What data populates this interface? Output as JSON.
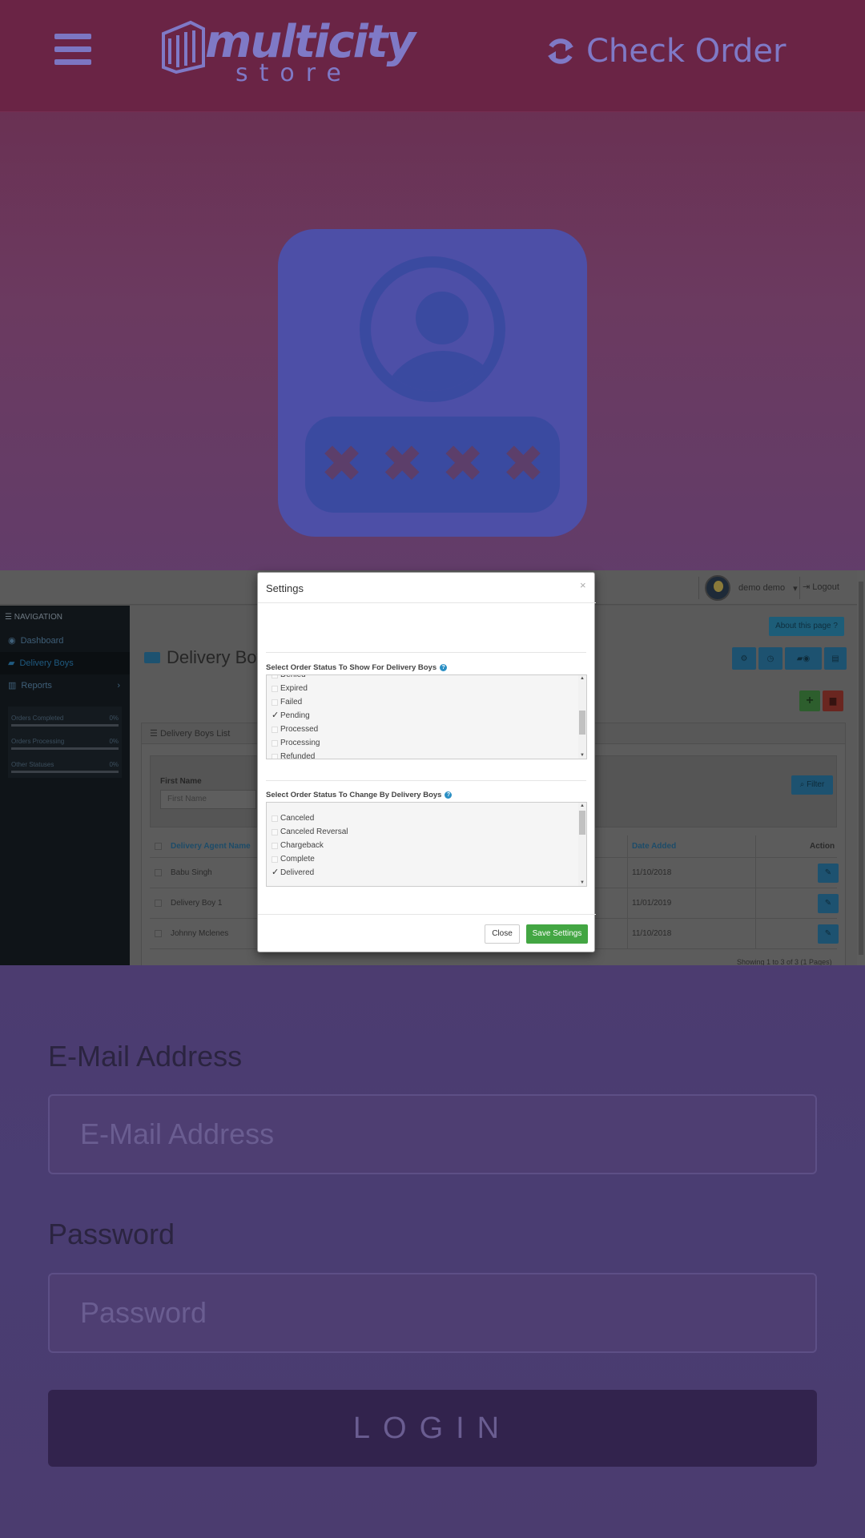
{
  "app": {
    "logo_word1": "multicity",
    "logo_word2": "store",
    "check_order_label": "Check Order"
  },
  "illustration": {
    "masked_password": [
      "✖",
      "✖",
      "✖",
      "✖"
    ]
  },
  "admin": {
    "user_name": "demo demo",
    "logout_label": "Logout",
    "nav_title": "NAVIGATION",
    "nav_items": [
      {
        "label": "Dashboard",
        "icon": "dashboard-icon"
      },
      {
        "label": "Delivery Boys",
        "icon": "truck-icon"
      },
      {
        "label": "Reports",
        "icon": "bar-chart-icon"
      }
    ],
    "stats": [
      {
        "label": "Orders Completed",
        "value": "0%"
      },
      {
        "label": "Orders Processing",
        "value": "0%"
      },
      {
        "label": "Other Statuses",
        "value": "0%"
      }
    ],
    "about_label": "About this page",
    "page_title": "Delivery Boys",
    "panel_title": "Delivery Boys List",
    "filter": {
      "label": "First Name",
      "placeholder": "First Name",
      "button_label": "Filter"
    },
    "table": {
      "headers": {
        "name": "Delivery Agent Name",
        "date": "Date Added",
        "action": "Action"
      },
      "rows": [
        {
          "name": "Babu Singh",
          "date": "11/10/2018"
        },
        {
          "name": "Delivery Boy 1",
          "date": "11/01/2019"
        },
        {
          "name": "Johnny Mclenes",
          "date": "11/10/2018"
        }
      ]
    },
    "showing_text": "Showing 1 to 3 of 3 (1 Pages)"
  },
  "modal": {
    "title": "Settings",
    "close_x": "×",
    "show_section_label": "Select Order Status To Show For Delivery Boys",
    "show_statuses": [
      {
        "label": "Denied",
        "checked": false
      },
      {
        "label": "Expired",
        "checked": false
      },
      {
        "label": "Failed",
        "checked": false
      },
      {
        "label": "Pending",
        "checked": true
      },
      {
        "label": "Processed",
        "checked": false
      },
      {
        "label": "Processing",
        "checked": false
      },
      {
        "label": "Refunded",
        "checked": false
      }
    ],
    "change_section_label": "Select Order Status To Change By Delivery Boys",
    "change_statuses": [
      {
        "label": "Canceled",
        "checked": false
      },
      {
        "label": "Canceled Reversal",
        "checked": false
      },
      {
        "label": "Chargeback",
        "checked": false
      },
      {
        "label": "Complete",
        "checked": false
      },
      {
        "label": "Delivered",
        "checked": true
      }
    ],
    "close_label": "Close",
    "save_label": "Save Settings"
  },
  "login_form": {
    "email_label": "E-Mail Address",
    "email_placeholder": "E-Mail Address",
    "password_label": "Password",
    "password_placeholder": "Password",
    "login_label": "LOGIN"
  },
  "colors": {
    "primary": "#2a8fc4",
    "success": "#43a643",
    "danger": "#c9302c",
    "background_top": "#6a2445",
    "background_bottom": "#4b3c6f"
  }
}
